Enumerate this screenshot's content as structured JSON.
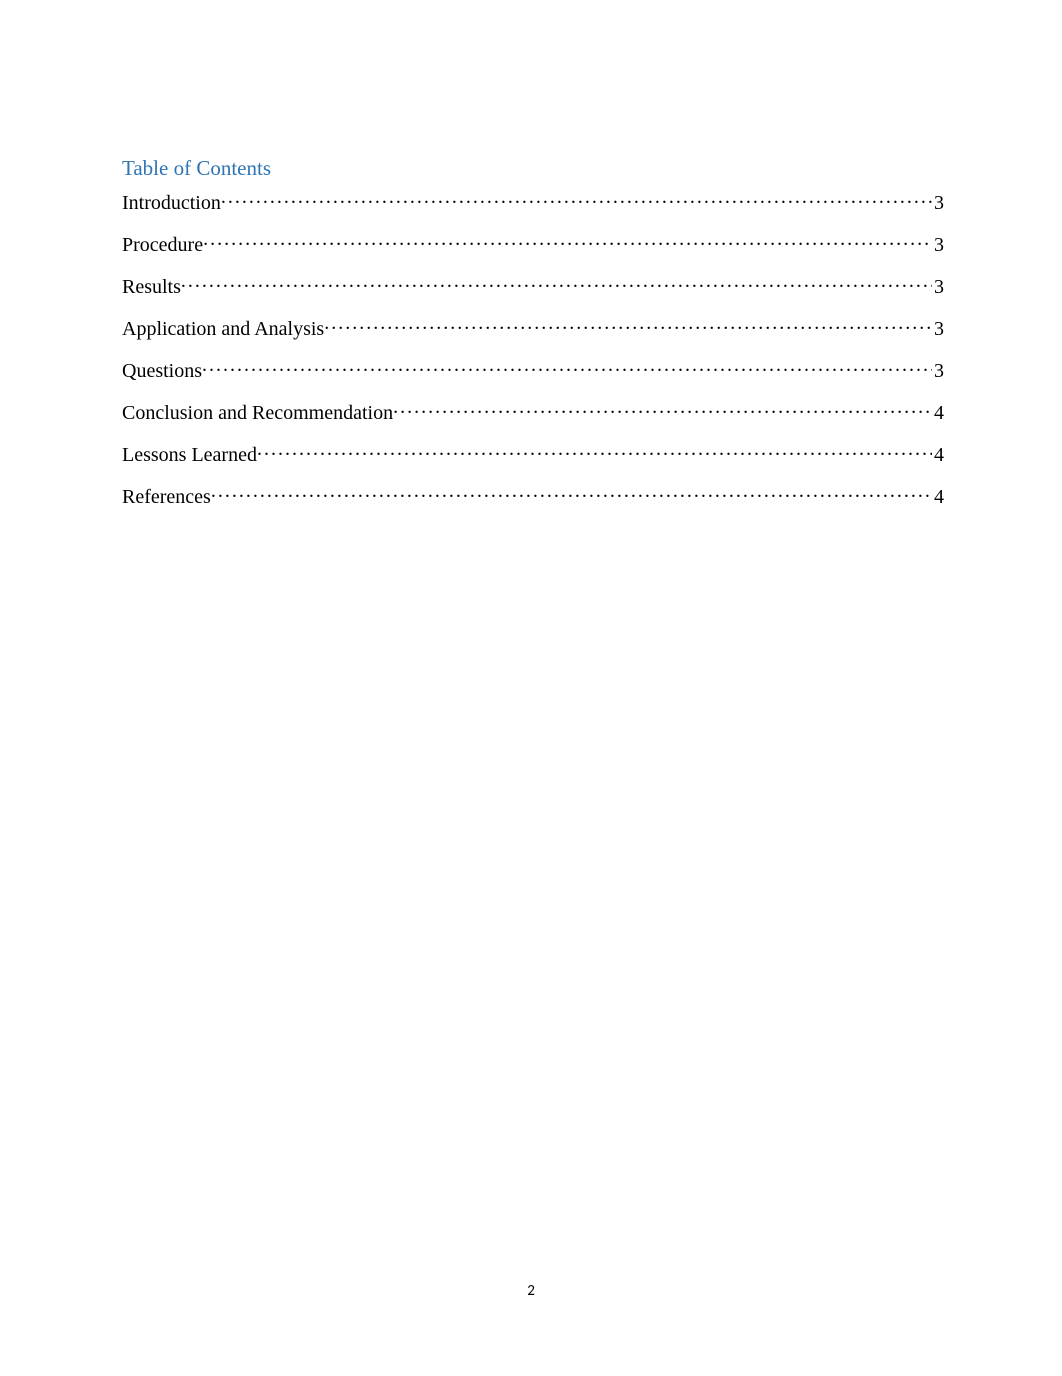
{
  "toc": {
    "heading": "Table of Contents",
    "entries": [
      {
        "label": "Introduction",
        "page": "3"
      },
      {
        "label": "Procedure",
        "page": "3"
      },
      {
        "label": "Results",
        "page": "3"
      },
      {
        "label": "Application and Analysis",
        "page": "3"
      },
      {
        "label": "Questions",
        "page": "3"
      },
      {
        "label": "Conclusion and Recommendation",
        "page": "4"
      },
      {
        "label": "Lessons Learned",
        "page": "4"
      },
      {
        "label": "References",
        "page": "4"
      }
    ]
  },
  "footer": {
    "page_number": "2"
  }
}
